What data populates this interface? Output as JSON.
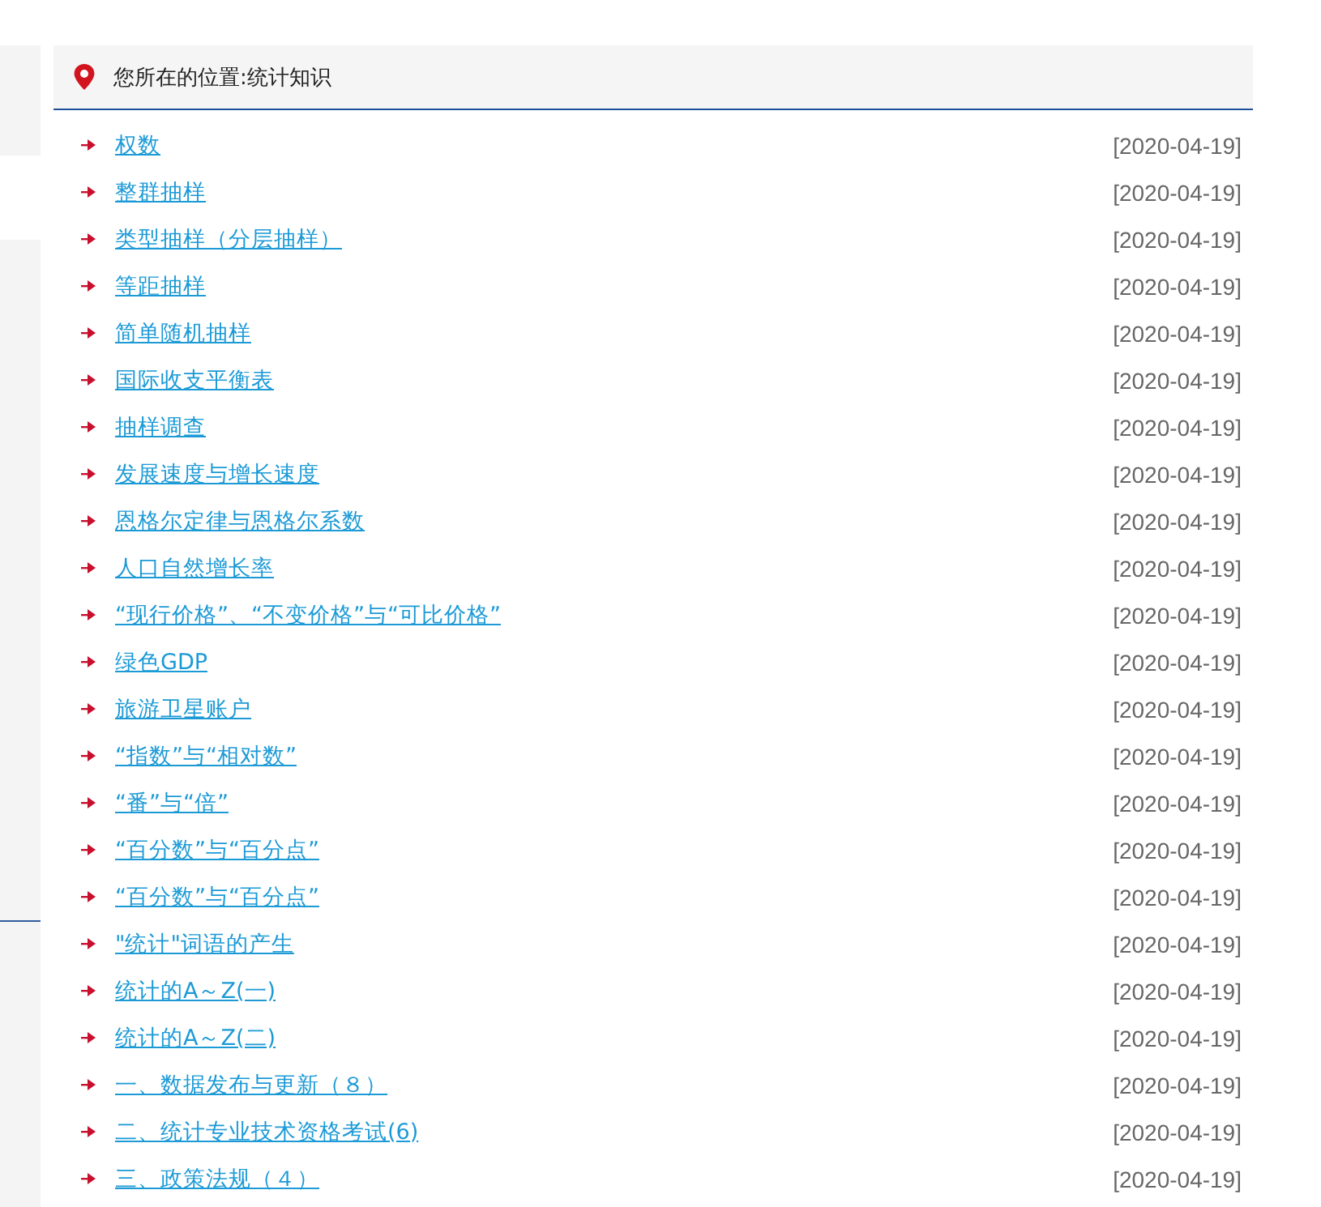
{
  "breadcrumb": {
    "label": "您所在的位置:统计知识"
  },
  "articles": [
    {
      "title": "权数",
      "date": "[2020-04-19]"
    },
    {
      "title": "整群抽样",
      "date": "[2020-04-19]"
    },
    {
      "title": "类型抽样（分层抽样）",
      "date": "[2020-04-19]"
    },
    {
      "title": "等距抽样",
      "date": "[2020-04-19]"
    },
    {
      "title": "简单随机抽样",
      "date": "[2020-04-19]"
    },
    {
      "title": "国际收支平衡表",
      "date": "[2020-04-19]"
    },
    {
      "title": "抽样调查",
      "date": "[2020-04-19]"
    },
    {
      "title": "发展速度与增长速度",
      "date": "[2020-04-19]"
    },
    {
      "title": "恩格尔定律与恩格尔系数",
      "date": "[2020-04-19]"
    },
    {
      "title": "人口自然增长率",
      "date": "[2020-04-19]"
    },
    {
      "title": "“现行价格”、“不变价格”与“可比价格”",
      "date": "[2020-04-19]"
    },
    {
      "title": "绿色GDP",
      "date": "[2020-04-19]"
    },
    {
      "title": "旅游卫星账户",
      "date": "[2020-04-19]"
    },
    {
      "title": "“指数”与“相对数”",
      "date": "[2020-04-19]"
    },
    {
      "title": "“番”与“倍”",
      "date": "[2020-04-19]"
    },
    {
      "title": "“百分数”与“百分点”",
      "date": "[2020-04-19]"
    },
    {
      "title": "“百分数”与“百分点”",
      "date": "[2020-04-19]"
    },
    {
      "title": "\"统计\"词语的产生",
      "date": "[2020-04-19]"
    },
    {
      "title": "统计的A～Z(一)",
      "date": "[2020-04-19]"
    },
    {
      "title": "统计的A～Z(二)",
      "date": "[2020-04-19]"
    },
    {
      "title": "一、数据发布与更新（８）",
      "date": "[2020-04-19]"
    },
    {
      "title": "二、统计专业技术资格考试(6)",
      "date": "[2020-04-19]"
    },
    {
      "title": "三、政策法规（４）",
      "date": "[2020-04-19]"
    }
  ]
}
